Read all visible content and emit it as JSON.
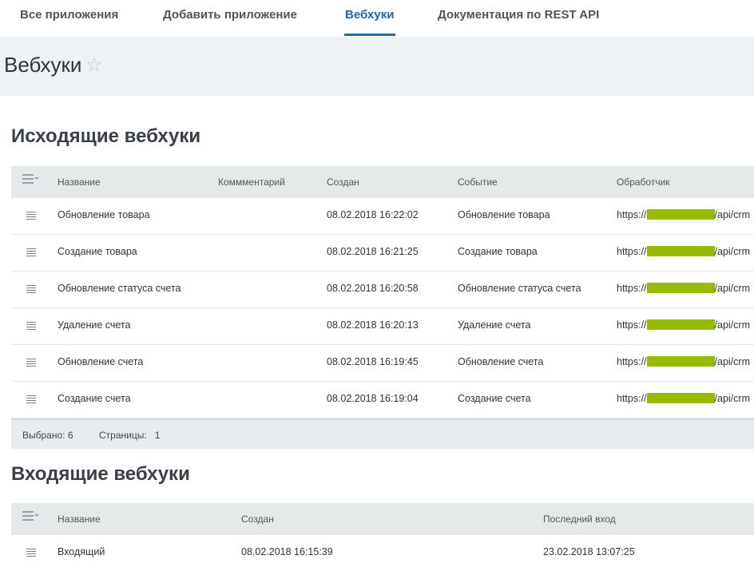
{
  "tabs": [
    {
      "label": "Все приложения",
      "active": false
    },
    {
      "label": "Добавить приложение",
      "active": false
    },
    {
      "label": "Вебхуки",
      "active": true
    },
    {
      "label": "Документация по REST API",
      "active": false
    }
  ],
  "page_title": "Вебхуки",
  "star_glyph": "☆",
  "outgoing": {
    "title": "Исходящие вебхуки",
    "columns": [
      "Название",
      "Коммментарий",
      "Создан",
      "Событие",
      "Обработчик"
    ],
    "rows": [
      {
        "name": "Обновление товара",
        "comment": "",
        "created": "08.02.2018 16:22:02",
        "event": "Обновление товара",
        "handler_prefix": "https://",
        "handler_suffix": "/api/crm"
      },
      {
        "name": "Создание товара",
        "comment": "",
        "created": "08.02.2018 16:21:25",
        "event": "Создание товара",
        "handler_prefix": "https://",
        "handler_suffix": "/api/crm"
      },
      {
        "name": "Обновление статуса счета",
        "comment": "",
        "created": "08.02.2018 16:20:58",
        "event": "Обновление статуса счета",
        "handler_prefix": "https://",
        "handler_suffix": "/api/crm"
      },
      {
        "name": "Удаление счета",
        "comment": "",
        "created": "08.02.2018 16:20:13",
        "event": "Удаление счета",
        "handler_prefix": "https://",
        "handler_suffix": "/api/crm"
      },
      {
        "name": "Обновление счета",
        "comment": "",
        "created": "08.02.2018 16:19:45",
        "event": "Обновление счета",
        "handler_prefix": "https://",
        "handler_suffix": "/api/crm"
      },
      {
        "name": "Создание счета",
        "comment": "",
        "created": "08.02.2018 16:19:04",
        "event": "Создание счета",
        "handler_prefix": "https://",
        "handler_suffix": "/api/crm"
      }
    ],
    "footer": {
      "selected_label": "Выбрано:",
      "selected_value": "6",
      "pages_label": "Страницы:",
      "pages_value": "1"
    }
  },
  "incoming": {
    "title": "Входящие вебхуки",
    "columns": [
      "Название",
      "Создан",
      "Последний вход"
    ],
    "rows": [
      {
        "name": "Входящий",
        "created": "08.02.2018 16:15:39",
        "last_login": "23.02.2018 13:07:25"
      }
    ]
  },
  "colors": {
    "accent": "#2067b0",
    "redaction": "#96bb00",
    "title_bg": "#eef2f4",
    "header_bg": "#e6e9ea"
  }
}
